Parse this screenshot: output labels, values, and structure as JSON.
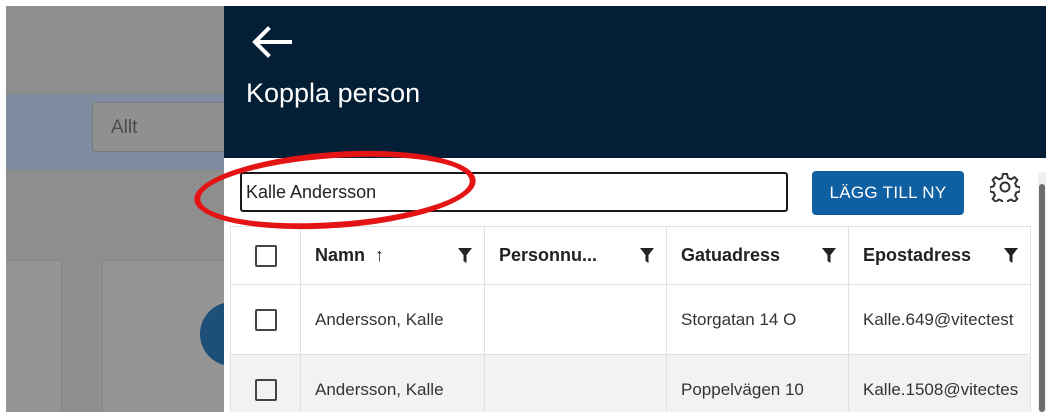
{
  "background": {
    "filter_value": "Allt"
  },
  "drawer": {
    "title": "Koppla person",
    "search": {
      "value": "Kalle Andersson",
      "placeholder": ""
    },
    "add_button_label": "LÄGG TILL NY",
    "icons": {
      "back": "arrow-left-icon",
      "settings": "gear-icon",
      "filter": "filter-icon",
      "sort": "arrow-up-icon"
    },
    "colors": {
      "header_bg": "#031e35",
      "button_bg": "#0f5fa3",
      "annotation": "#e41414"
    },
    "table": {
      "columns": [
        {
          "label": "Namn",
          "sort_indicator": "↑"
        },
        {
          "label": "Personnu..."
        },
        {
          "label": "Gatuadress"
        },
        {
          "label": "Epostadress"
        }
      ],
      "rows": [
        {
          "name": "Andersson, Kalle",
          "personnummer": "",
          "address": "Storgatan 14 O",
          "email": "Kalle.649@vitectest"
        },
        {
          "name": "Andersson, Kalle",
          "personnummer": "",
          "address": "Poppelvägen 10",
          "email": "Kalle.1508@vitectes"
        }
      ]
    }
  }
}
